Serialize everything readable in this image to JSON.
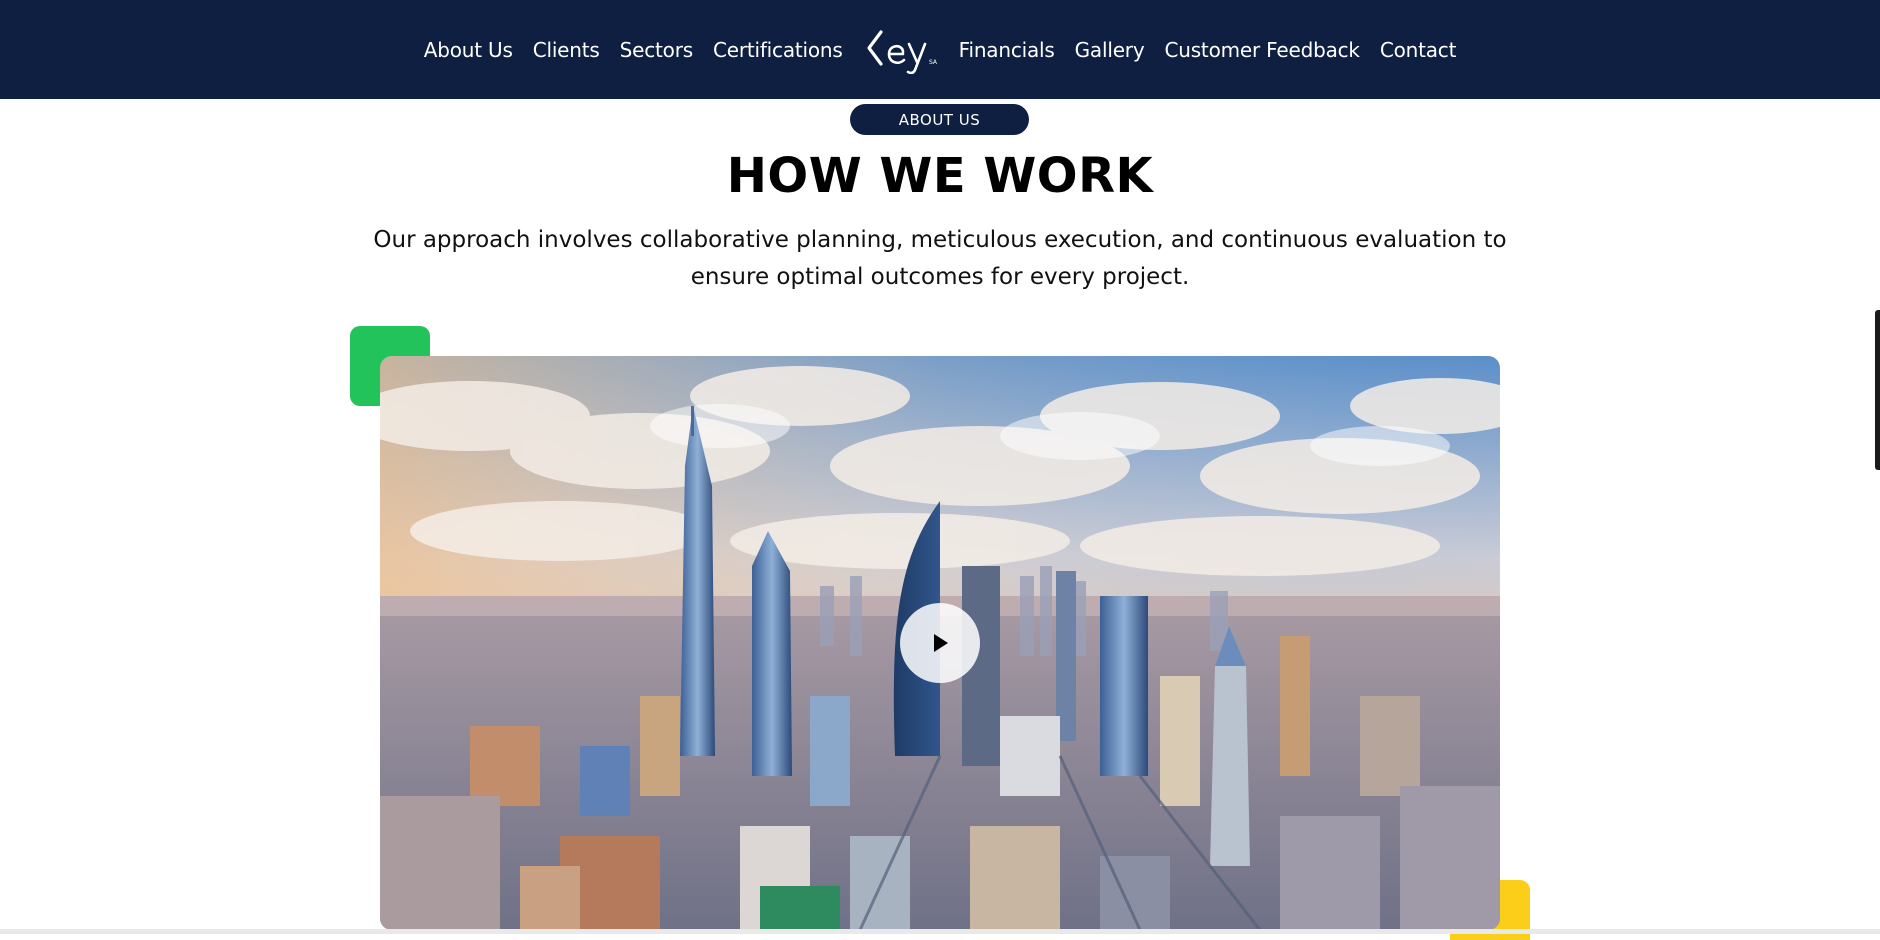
{
  "nav": {
    "left_links": [
      "About Us",
      "Clients",
      "Sectors",
      "Certifications"
    ],
    "right_links": [
      "Financials",
      "Gallery",
      "Customer Feedback",
      "Contact"
    ],
    "logo_text": "Key",
    "logo_suffix": "SA"
  },
  "section": {
    "badge": "ABOUT US",
    "title": "HOW WE WORK",
    "description": "Our approach involves collaborative planning, meticulous execution, and continuous evaluation to ensure optimal outcomes for every project."
  },
  "video": {
    "play_icon": "play-icon"
  },
  "colors": {
    "navy": "#0e1f42",
    "green_accent": "#21c35a",
    "yellow_accent": "#fbcf19"
  }
}
